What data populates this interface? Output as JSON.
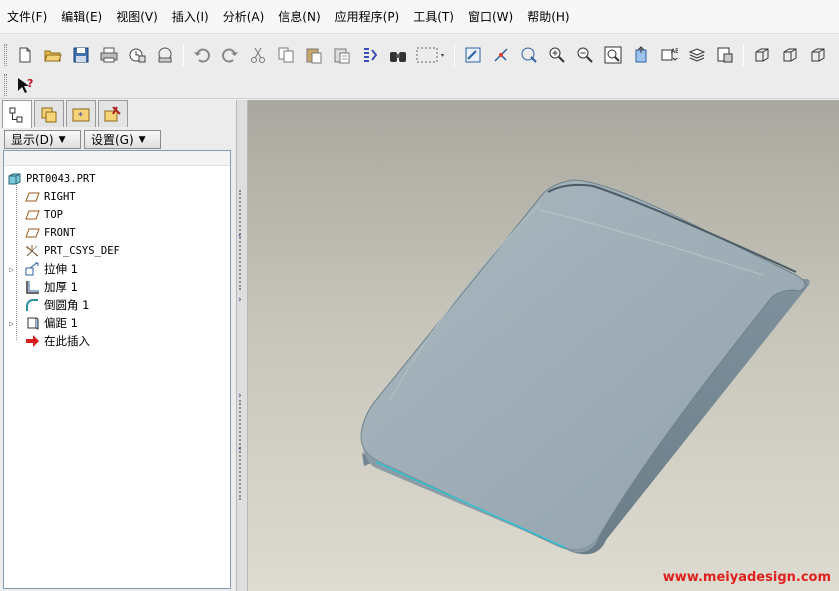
{
  "menu": [
    {
      "label": "文件(F)"
    },
    {
      "label": "编辑(E)"
    },
    {
      "label": "视图(V)"
    },
    {
      "label": "插入(I)"
    },
    {
      "label": "分析(A)"
    },
    {
      "label": "信息(N)"
    },
    {
      "label": "应用程序(P)"
    },
    {
      "label": "工具(T)"
    },
    {
      "label": "窗口(W)"
    },
    {
      "label": "帮助(H)"
    }
  ],
  "toolbar_icons": [
    "new-file-icon",
    "open-folder-icon",
    "save-icon",
    "print-icon",
    "send-mail-icon",
    "mail-attach-icon",
    "undo-icon",
    "redo-icon",
    "cut-icon",
    "copy-icon",
    "paste-icon",
    "paste-special-icon",
    "regenerate-icon",
    "find-binoculars-icon",
    "select-box-icon",
    "repaint-icon",
    "spin-center-icon",
    "orient-icon",
    "zoom-in-icon",
    "zoom-out-icon",
    "refit-icon",
    "reorient-icon",
    "saved-views-icon",
    "layers-icon",
    "view-manager-icon",
    "shading-icon",
    "hidden-line-icon",
    "whats-this-icon"
  ],
  "left_panel": {
    "tabs": [
      "model-tree-tab",
      "folder-browser-tab",
      "favorites-tab",
      "connections-tab"
    ],
    "show_button": "显示(D)",
    "settings_button": "设置(G)",
    "tree": {
      "root": "PRT0043.PRT",
      "items": [
        {
          "label": "RIGHT",
          "icon": "datum-plane-icon",
          "expandable": false
        },
        {
          "label": "TOP",
          "icon": "datum-plane-icon",
          "expandable": false
        },
        {
          "label": "FRONT",
          "icon": "datum-plane-icon",
          "expandable": false
        },
        {
          "label": "PRT_CSYS_DEF",
          "icon": "coordinate-system-icon",
          "expandable": false
        },
        {
          "label": "拉伸 1",
          "icon": "extrude-icon",
          "expandable": true
        },
        {
          "label": "加厚 1",
          "icon": "thicken-icon",
          "expandable": false
        },
        {
          "label": "倒圆角 1",
          "icon": "round-icon",
          "expandable": false
        },
        {
          "label": "偏距 1",
          "icon": "offset-icon",
          "expandable": true
        },
        {
          "label": "在此插入",
          "icon": "insert-here-icon",
          "expandable": false
        }
      ]
    }
  },
  "viewport": {
    "watermark": "www.meiyadesign.com",
    "model_color": "#98a8b2",
    "edge_highlight_color": "#22c8d8"
  }
}
